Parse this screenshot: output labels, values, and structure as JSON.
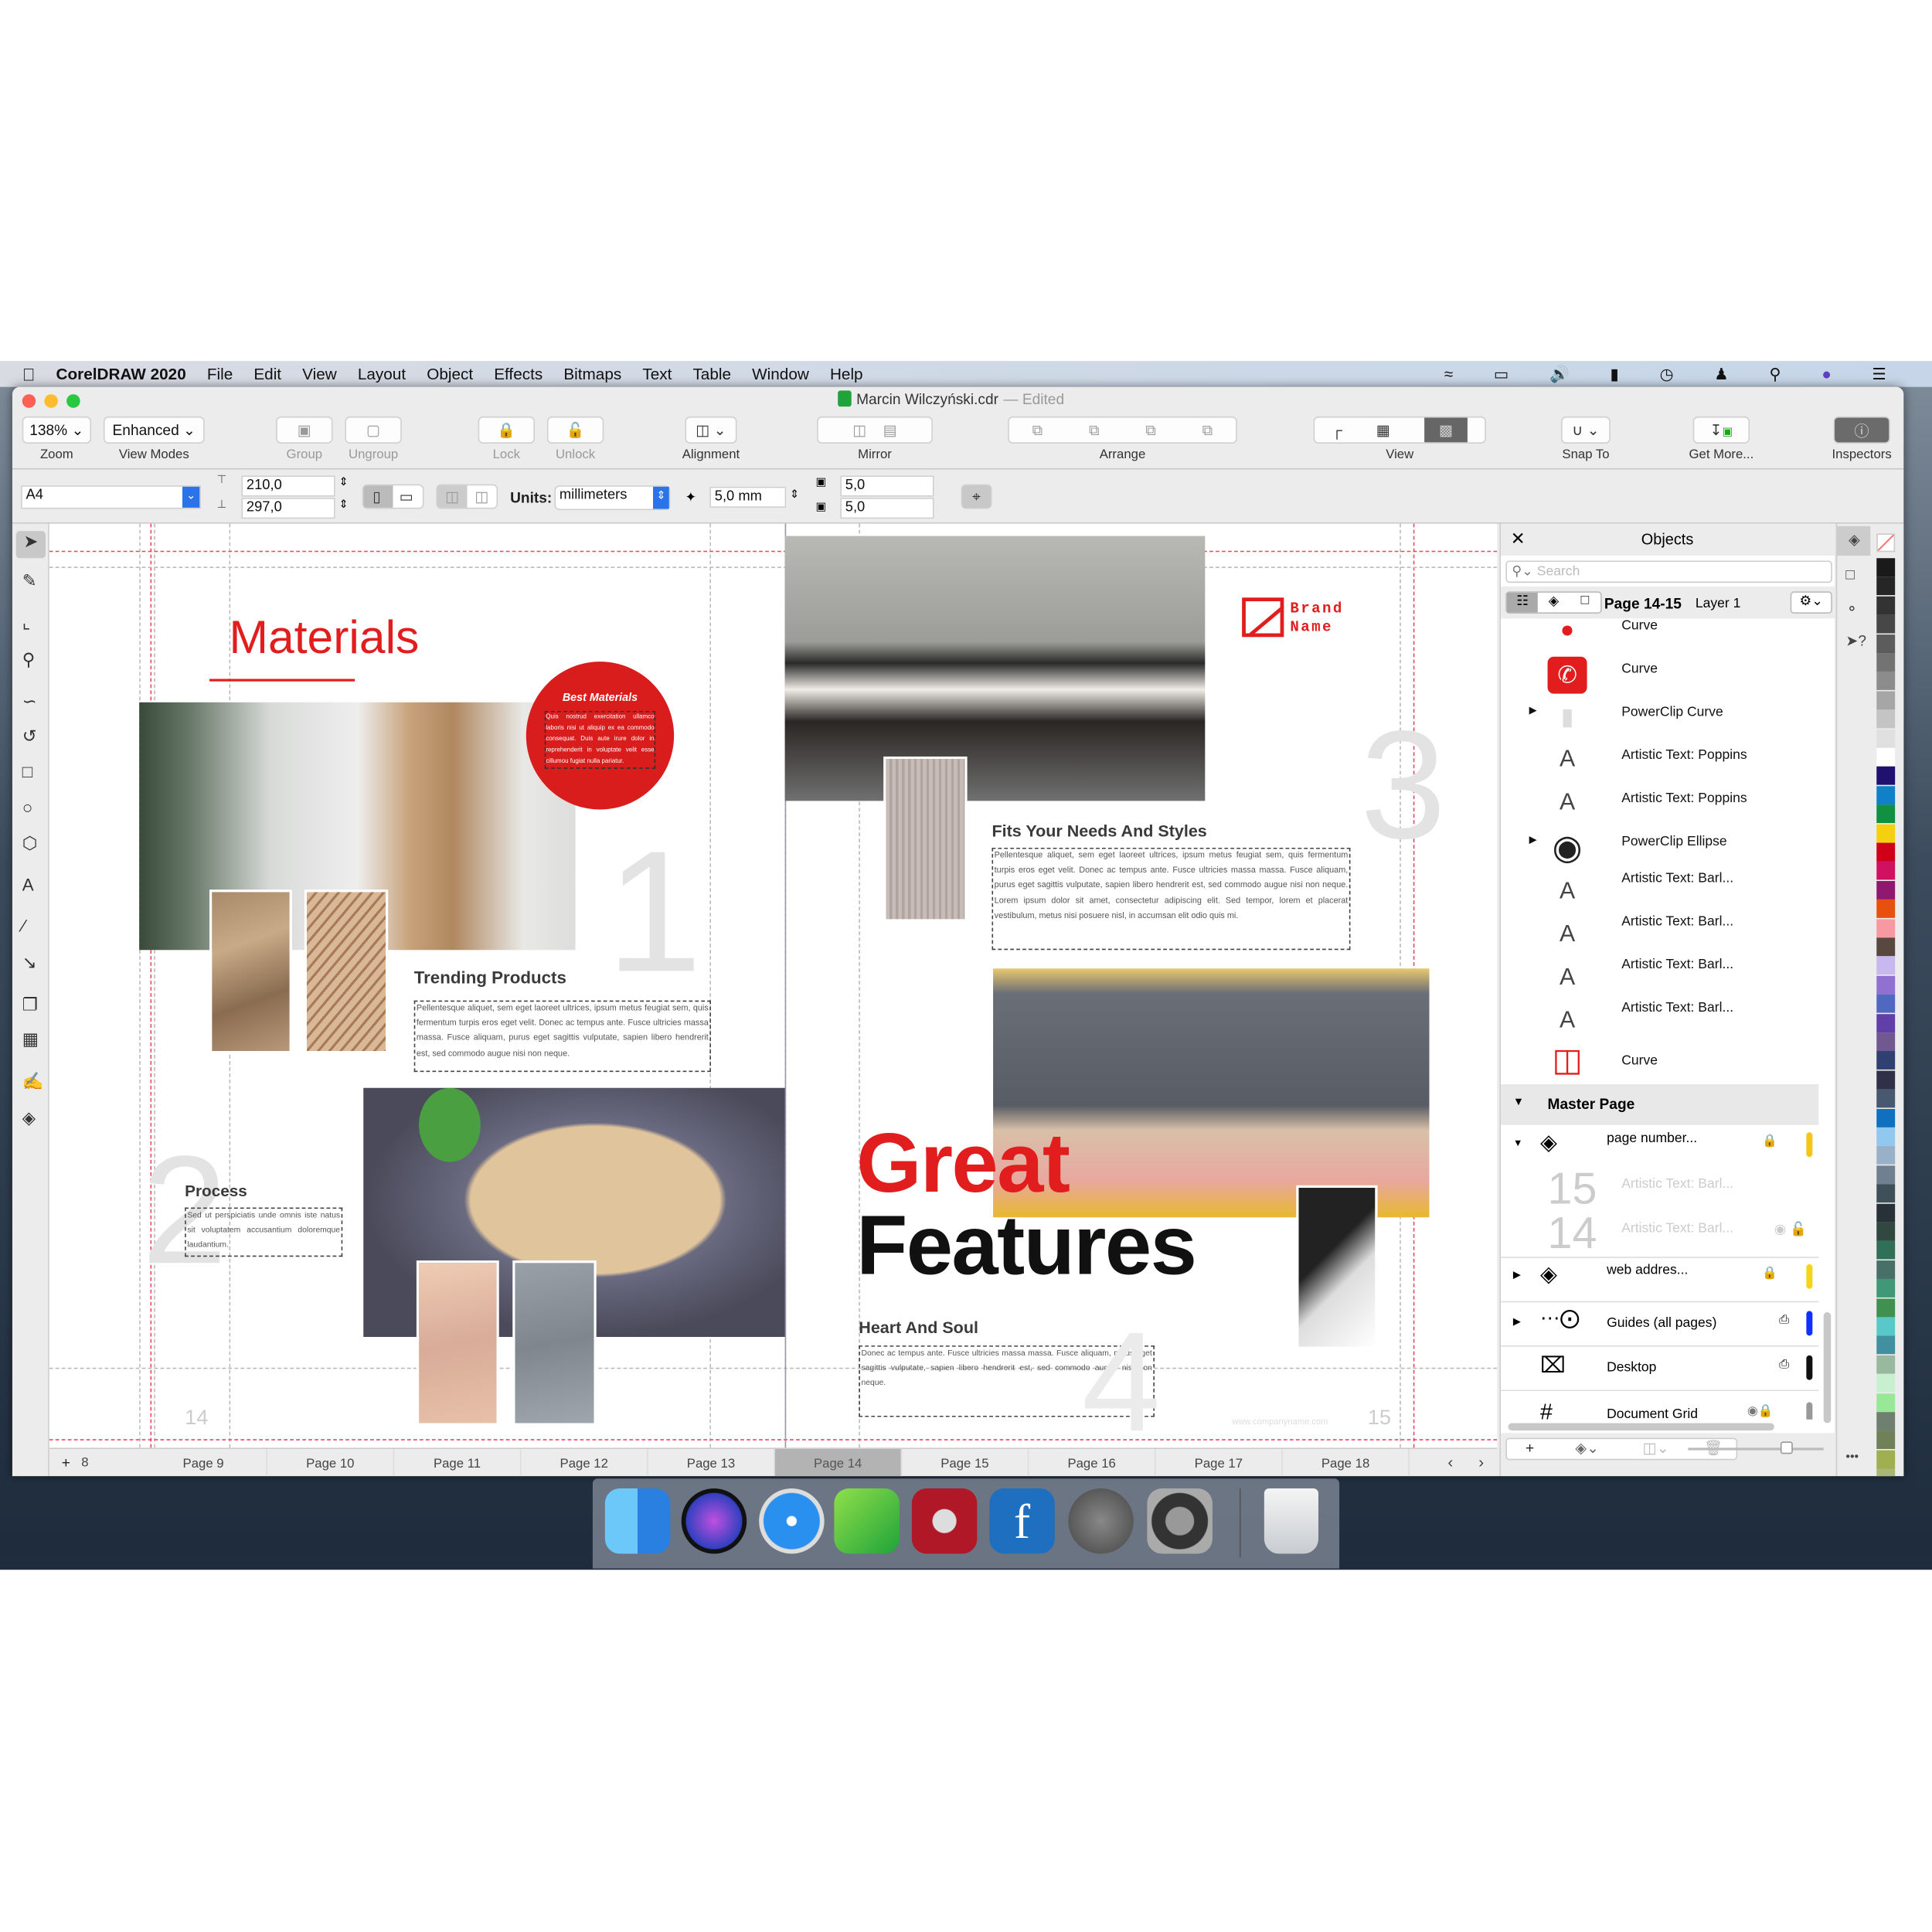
{
  "menubar": {
    "app": "CorelDRAW 2020",
    "items": [
      "File",
      "Edit",
      "View",
      "Layout",
      "Object",
      "Effects",
      "Bitmaps",
      "Text",
      "Table",
      "Window",
      "Help"
    ],
    "status_icons": [
      "wifi-icon",
      "airplay-icon",
      "volume-icon",
      "battery-icon",
      "clock-icon",
      "user-icon",
      "spotlight-search-icon",
      "siri-icon",
      "notification-center-icon"
    ]
  },
  "window": {
    "title": "Marcin Wilczyński.cdr",
    "title_suffix": "— Edited"
  },
  "toolbar": {
    "zoom": "138%",
    "zoom_label": "Zoom",
    "view_mode": "Enhanced",
    "view_mode_label": "View Modes",
    "group": "Group",
    "ungroup": "Ungroup",
    "lock": "Lock",
    "unlock": "Unlock",
    "alignment": "Alignment",
    "mirror": "Mirror",
    "arrange": "Arrange",
    "view": "View",
    "snap_to": "Snap To",
    "get_more": "Get More...",
    "inspectors": "Inspectors"
  },
  "propbar": {
    "page_size": "A4",
    "width": "210,0",
    "height": "297,0",
    "units_label": "Units:",
    "units": "millimeters",
    "nudge": "5,0 mm",
    "dup_x": "5,0",
    "dup_y": "5,0"
  },
  "document": {
    "left": {
      "title": "Materials",
      "badge_title": "Best Materials",
      "badge_text": "Quis nostrud exercitation ullamco laboris nisi ut aliquip ex ea commodo consequat. Duis aute irure dolor in reprehenderit in voluptate velit esse cillumou fugiat nulla pariatur.",
      "num1": "1",
      "trending_title": "Trending Products",
      "trending_text": "Pellentesque aliquet, sem eget laoreet ultrices, ipsum metus feugiat sem, quis fermentum turpis eros eget velit. Donec ac tempus ante. Fusce ultricies massa massa. Fusce aliquam, purus eget sagittis vulputate, sapien libero hendrerit est, sed commodo augue nisi non neque.",
      "process_title": "Process",
      "process_text": "Sed ut perspiciatis unde omnis iste natus sit voluptatem accusantium doloremque laudantium.",
      "num2": "2",
      "page_number": "14"
    },
    "right": {
      "brand_line1": "Brand",
      "brand_line2": "Name",
      "num3": "3",
      "fits_title": "Fits Your Needs And Styles",
      "fits_text": "Pellentesque aliquet, sem eget laoreet ultrices, ipsum metus feugiat sem, quis fermentum turpis eros eget velit. Donec ac tempus ante. Fusce ultricies massa massa. Fusce aliquam, purus eget sagittis vulputate, sapien libero hendrerit est, sed commodo augue nisi non neque. Lorem ipsum dolor sit amet, consectetur adipiscing elit. Sed tempor, lorem et placerat vestibulum, metus nisi posuere nisl, in accumsan elit odio quis mi.",
      "great": "Great",
      "features": "Features",
      "heart_title": "Heart And Soul",
      "heart_text": "Donec ac tempus ante. Fusce ultricies massa massa. Fusce aliquam, purus eget sagittis vulputate, sapien libero hendrerit est, sed commodo augue nisi non neque.",
      "num4": "4",
      "web": "www.companyname.com",
      "page_number": "15"
    },
    "accent": "#e11d1d"
  },
  "objects": {
    "title": "Objects",
    "search_placeholder": "Search",
    "page": "Page 14-15",
    "layer": "Layer 1",
    "items": [
      {
        "label": "Curve",
        "icon": "red-curve-icon"
      },
      {
        "label": "Curve",
        "icon": "phone-icon"
      },
      {
        "label": "PowerClip Curve",
        "icon": "powerclip-icon"
      },
      {
        "label": "Artistic Text: Poppins",
        "icon": "text-icon"
      },
      {
        "label": "Artistic Text: Poppins",
        "icon": "text-icon"
      },
      {
        "label": "PowerClip Ellipse",
        "icon": "qr-ellipse-icon"
      },
      {
        "label": "Artistic Text: Barl...",
        "icon": "text-icon"
      },
      {
        "label": "Artistic Text: Barl...",
        "icon": "text-icon"
      },
      {
        "label": "Artistic Text: Barl...",
        "icon": "text-icon"
      },
      {
        "label": "Artistic Text: Barl...",
        "icon": "text-icon"
      },
      {
        "label": "Curve",
        "icon": "brand-logo-icon"
      }
    ],
    "master_page": "Master Page",
    "master_items": [
      {
        "label": "page number...",
        "color": "#f5c518"
      },
      {
        "label": "Artistic Text: Barl...",
        "thumb": "15"
      },
      {
        "label": "Artistic Text: Barl...",
        "thumb": "14"
      },
      {
        "label": "web addres...",
        "color": "#f5d518"
      },
      {
        "label": "Guides (all pages)",
        "color": "#1030ff"
      },
      {
        "label": "Desktop",
        "color": "#111111"
      },
      {
        "label": "Document Grid",
        "color": "#999999"
      }
    ]
  },
  "palette": [
    "#1a1a1a",
    "#262626",
    "#333333",
    "#474747",
    "#5c5c5c",
    "#737373",
    "#8c8c8c",
    "#a6a6a6",
    "#c4c4c4",
    "#e0e0e0",
    "#ffffff",
    "#201070",
    "#1080c8",
    "#109040",
    "#f5d010",
    "#d00018",
    "#d01060",
    "#901870",
    "#e85010",
    "#f898a0",
    "#584840",
    "#c8b8f0",
    "#9070d0",
    "#5068c0",
    "#6040a8",
    "#705890",
    "#304070",
    "#303048",
    "#485870",
    "#1070c0",
    "#90c8f0",
    "#98b0c8",
    "#708090",
    "#405058",
    "#283038",
    "#304840",
    "#307058",
    "#487068",
    "#409878",
    "#409050",
    "#58c8c8",
    "#4090a0",
    "#98b8a0",
    "#c8f0d0",
    "#98e898",
    "#708070",
    "#708058",
    "#a0b050",
    "#a8b870"
  ],
  "pages": {
    "count": "8",
    "tabs": [
      "Page 9",
      "Page 10",
      "Page 11",
      "Page 12",
      "Page 13",
      "Page 14",
      "Page 15",
      "Page 16",
      "Page 17",
      "Page 18"
    ],
    "selected": "Page 14"
  },
  "dock": [
    "Finder",
    "Siri",
    "Safari",
    "CorelDRAW",
    "Photo Booth",
    "Font app",
    "Launchpad",
    "System Preferences",
    "Trash"
  ]
}
